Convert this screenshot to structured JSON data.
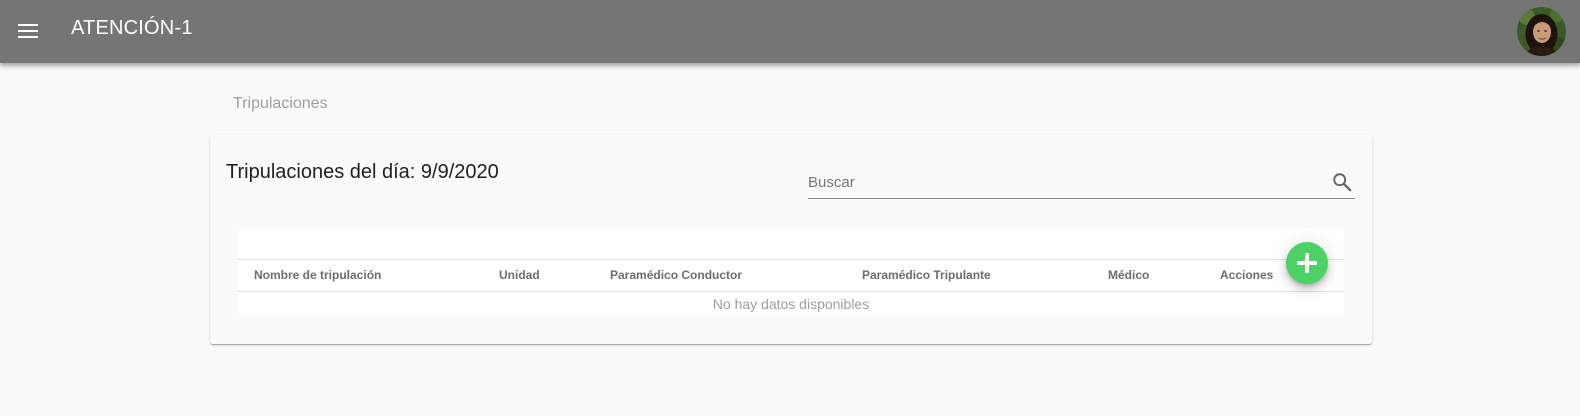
{
  "appbar": {
    "title": "ATENCIÓN-1",
    "menu_icon": "menu-icon",
    "avatar_icon": "user-avatar",
    "background_color": "#757575"
  },
  "breadcrumb": {
    "label": "Tripulaciones"
  },
  "card": {
    "title": "Tripulaciones del día: 9/9/2020",
    "search": {
      "placeholder": "Buscar",
      "value": "",
      "icon": "search-icon"
    },
    "table": {
      "columns": [
        "Nombre de tripulación",
        "Unidad",
        "Paramédico Conductor",
        "Paramédico Tripulante",
        "Médico",
        "Acciones"
      ],
      "rows": [],
      "empty_message": "No hay datos disponibles"
    },
    "add_button": {
      "icon": "plus-icon",
      "color": "#4cd264"
    }
  }
}
